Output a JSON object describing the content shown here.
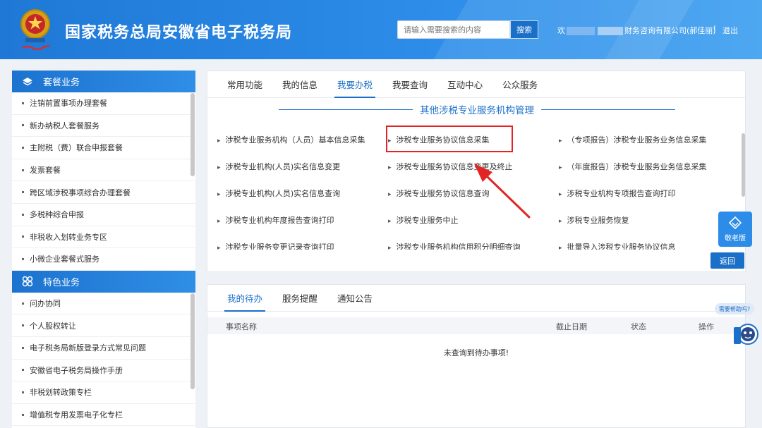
{
  "header": {
    "title": "国家税务总局安徽省电子税务局",
    "search_placeholder": "请输入需要搜索的内容",
    "search_button": "搜索",
    "welcome_prefix": "欢",
    "welcome_suffix": "财务咨询有限公司(郝佳丽)",
    "separator": "|",
    "logout": "退出"
  },
  "sidebar": {
    "group1": {
      "title": "套餐业务",
      "items": [
        "注销前置事项办理套餐",
        "新办纳税人套餐服务",
        "主附税（费）联合申报套餐",
        "发票套餐",
        "跨区域涉税事项综合办理套餐",
        "多税种综合申报",
        "非税收入划转业务专区",
        "小微企业套餐式服务"
      ]
    },
    "group2": {
      "title": "特色业务",
      "items": [
        "问办协同",
        "个人股权转让",
        "电子税务局新版登录方式常见问题",
        "安徽省电子税务局操作手册",
        "非税划转政策专栏",
        "增值税专用发票电子化专栏"
      ]
    }
  },
  "main": {
    "tabs": [
      "常用功能",
      "我的信息",
      "我要办税",
      "我要查询",
      "互动中心",
      "公众服务"
    ],
    "active_tab": 2,
    "section_title": "其他涉税专业服务机构管理",
    "functions": [
      "涉税专业服务机构（人员）基本信息采集",
      "涉税专业服务协议信息采集",
      "（专项报告）涉税专业服务业务信息采集",
      "涉税专业机构(人员)实名信息变更",
      "涉税专业服务协议信息变更及终止",
      "（年度报告）涉税专业服务业务信息采集",
      "涉税专业机构(人员)实名信息查询",
      "涉税专业服务协议信息查询",
      "涉税专业机构专项报告查询打印",
      "涉税专业机构年度报告查询打印",
      "涉税专业服务中止",
      "涉税专业服务恢复",
      "涉税专业服务变更记录查询打印",
      "涉税专业服务机构信用积分明细查询",
      "批量导入涉税专业服务协议信息"
    ],
    "return_button": "返回"
  },
  "lower": {
    "tabs": [
      "我的待办",
      "服务提醒",
      "通知公告"
    ],
    "active_tab": 0,
    "columns": [
      "事项名称",
      "截止日期",
      "状态",
      "操作"
    ],
    "empty_message": "未查询到待办事项!"
  },
  "widgets": {
    "elder_mode": "敬老版",
    "help_bubble": "需要帮助吗?"
  },
  "colors": {
    "brand_blue": "#1a6fc9",
    "header_blue": "#2c8ce8",
    "highlight_red": "#e32424"
  }
}
